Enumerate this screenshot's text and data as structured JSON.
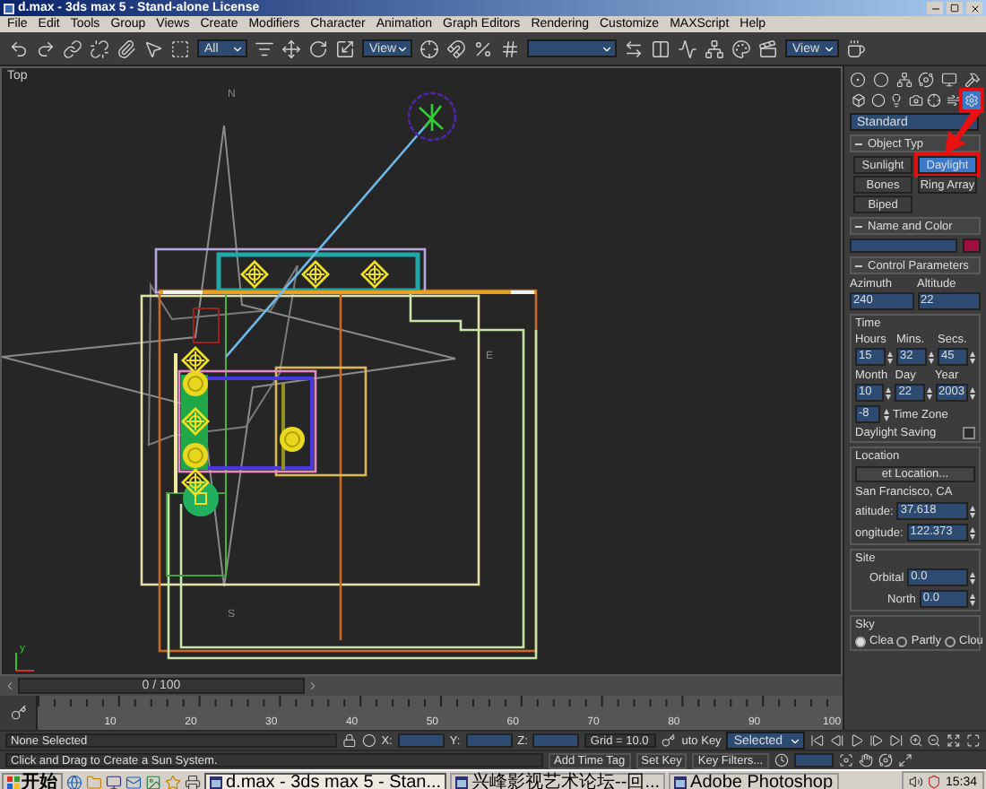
{
  "window": {
    "title": "d.max - 3ds max 5 - Stand-alone License"
  },
  "menu": [
    "File",
    "Edit",
    "Tools",
    "Group",
    "Views",
    "Create",
    "Modifiers",
    "Character",
    "Animation",
    "Graph Editors",
    "Rendering",
    "Customize",
    "MAXScript",
    "Help"
  ],
  "toolbar": {
    "selection_filter": "All",
    "reference_coords": "View",
    "render_target": "View"
  },
  "viewport": {
    "label": "Top",
    "compass": [
      {
        "label": "N"
      },
      {
        "label": "E"
      },
      {
        "label": "S"
      }
    ],
    "axis_label": "y"
  },
  "command_panel": {
    "category_tabs": [
      {
        "selected": false,
        "marked": false
      },
      {
        "selected": false,
        "marked": false
      },
      {
        "selected": false,
        "marked": false
      },
      {
        "selected": false,
        "marked": false
      },
      {
        "selected": false,
        "marked": false
      },
      {
        "selected": false,
        "marked": false
      },
      {
        "selected": true,
        "marked": true
      }
    ],
    "category": "Standard",
    "object_type": {
      "title": "Object Typ",
      "buttons": [
        {
          "label": "Sunlight",
          "selected": false,
          "marked": false
        },
        {
          "label": "Daylight",
          "selected": true,
          "marked": true
        },
        {
          "label": "Bones",
          "selected": false,
          "marked": false
        },
        {
          "label": "Ring Array",
          "selected": false,
          "marked": false
        },
        {
          "label": "Biped",
          "selected": false,
          "marked": false
        }
      ]
    },
    "name_and_color": {
      "title": "Name and Color"
    },
    "control_parameters": {
      "title": "Control Parameters",
      "angles": [
        {
          "label": "Azimuth",
          "value": "240"
        },
        {
          "label": "Altitude",
          "value": "22"
        }
      ],
      "time_title": "Time",
      "time": [
        {
          "label": "Hours",
          "value": "15"
        },
        {
          "label": "Mins.",
          "value": "32"
        },
        {
          "label": "Secs.",
          "value": "45"
        }
      ],
      "date": [
        {
          "label": "Month",
          "value": "10"
        },
        {
          "label": "Day",
          "value": "22"
        },
        {
          "label": "Year",
          "value": "2003"
        }
      ],
      "time_zone": {
        "value": "-8",
        "label": "Time Zone"
      },
      "daylight_saving": {
        "label": "Daylight Saving",
        "checked": false
      },
      "location_title": "Location",
      "get_location": "et Location...",
      "city": "San Francisco, CA",
      "coords": [
        {
          "label": "atitude:",
          "value": "37.618"
        },
        {
          "label": "ongitude:",
          "value": "122.373"
        }
      ],
      "site_title": "Site",
      "site": [
        {
          "label": "Orbital",
          "value": "0.0"
        },
        {
          "label": "North",
          "value": "0.0"
        }
      ],
      "sky_title": "Sky",
      "sky": [
        {
          "label": "Clea",
          "selected": true
        },
        {
          "label": "Partly",
          "selected": false
        },
        {
          "label": "Clou",
          "selected": false
        }
      ]
    }
  },
  "time_slider": {
    "label": "0 / 100"
  },
  "track_ticks": [
    "10",
    "20",
    "30",
    "40",
    "50",
    "60",
    "70",
    "80",
    "90",
    "100"
  ],
  "status": {
    "selection": "None Selected",
    "axes": [
      {
        "label": "X:"
      },
      {
        "label": "Y:"
      },
      {
        "label": "Z:"
      }
    ],
    "grid": "Grid = 10.0",
    "auto_key": "uto Key",
    "key_mode": "Selected",
    "prompt": "Click and Drag to Create a Sun System.",
    "time_tag": "Add Time Tag",
    "set_key": "Set Key",
    "key_filters": "Key Filters..."
  },
  "taskbar": {
    "start": "开始",
    "tasks": [
      {
        "label": "d.max - 3ds max 5 - Stan...",
        "selected": true
      },
      {
        "label": "兴峰影视艺术论坛--回...",
        "selected": false
      },
      {
        "label": "Adobe Photoshop",
        "selected": false
      }
    ],
    "clock": "15:34"
  }
}
